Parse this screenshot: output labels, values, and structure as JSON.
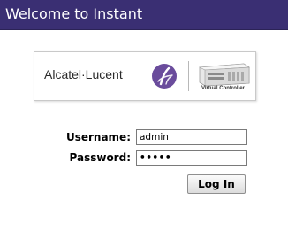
{
  "header": {
    "title": "Welcome to Instant",
    "background_color": "#3a2f73"
  },
  "logo": {
    "brand_name": "Alcatel·Lucent",
    "brand_icon": "alcatel-lucent-logo-icon",
    "brand_color": "#6a4c9c",
    "product_icon": "virtual-controller-device-icon",
    "product_caption": "Virtual Controller"
  },
  "login_form": {
    "username_label": "Username:",
    "username_value": "admin",
    "password_label": "Password:",
    "password_value": "•••••",
    "login_button_label": "Log In"
  }
}
